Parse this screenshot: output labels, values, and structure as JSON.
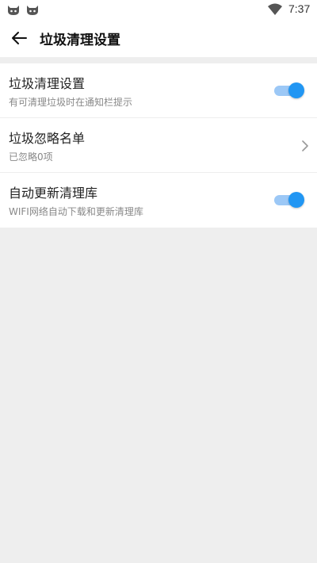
{
  "status_bar": {
    "time": "7:37",
    "icons": [
      "cat-notification-icon",
      "cat-notification-icon",
      "wifi-icon"
    ]
  },
  "app_bar": {
    "back_icon": "arrow-left-icon",
    "title": "垃圾清理设置"
  },
  "settings": [
    {
      "title": "垃圾清理设置",
      "subtitle": "有可清理垃圾时在通知栏提示",
      "control": "toggle",
      "enabled": true
    },
    {
      "title": "垃圾忽略名单",
      "subtitle": "已忽略0项",
      "control": "chevron"
    },
    {
      "title": "自动更新清理库",
      "subtitle": "WIFI网络自动下载和更新清理库",
      "control": "toggle",
      "enabled": true
    }
  ],
  "colors": {
    "accent": "#2196f3",
    "accent_track": "#9cc8f6",
    "background": "#eeeeee"
  }
}
